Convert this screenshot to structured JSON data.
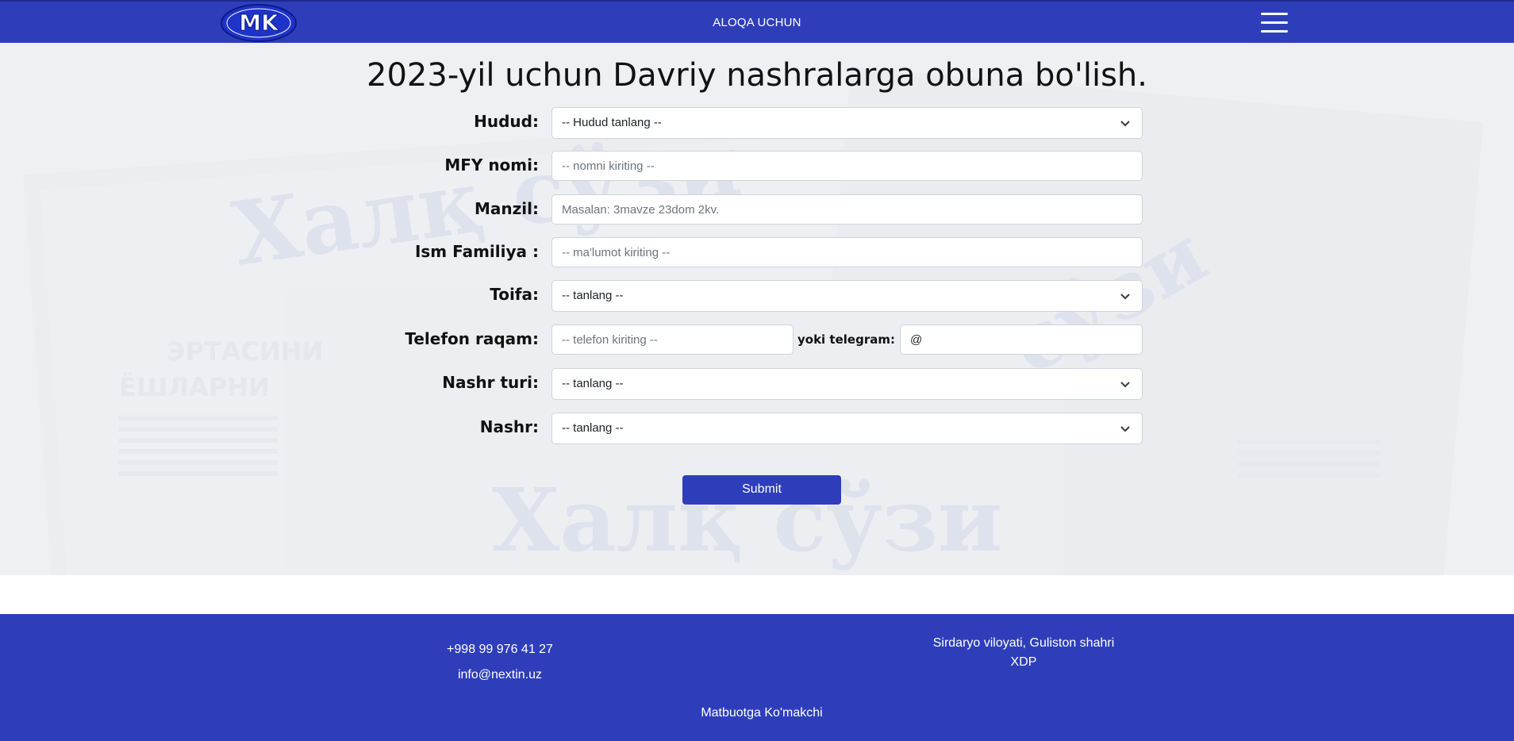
{
  "header": {
    "logo_text": "MK",
    "nav_link": "ALOQA UCHUN",
    "menu_icon": "hamburger-menu-icon"
  },
  "form": {
    "title": "2023-yil uchun Davriy nashralarga obuna bo'lish.",
    "hudud": {
      "label": "Hudud:",
      "value": "-- Hudud tanlang --"
    },
    "mfy": {
      "label": "MFY nomi:",
      "placeholder": "-- nomni kiriting --"
    },
    "manzil": {
      "label": "Manzil:",
      "placeholder": "Masalan: 3mavze 23dom 2kv."
    },
    "ism": {
      "label": "Ism Familiya :",
      "placeholder": "-- ma'lumot kiriting --"
    },
    "toifa": {
      "label": "Toifa:",
      "value": "-- tanlang --"
    },
    "telefon": {
      "label": "Telefon raqam:",
      "placeholder": "-- telefon kiriting --",
      "telegram_label": "yoki telegram:",
      "telegram_value": "@"
    },
    "nashr_turi": {
      "label": "Nashr turi:",
      "value": "-- tanlang --"
    },
    "nashr": {
      "label": "Nashr:",
      "value": "-- tanlang --"
    },
    "submit": "Submit"
  },
  "footer": {
    "phone": "+998 99 976 41 27",
    "email": "info@nextin.uz",
    "address_line1": "Sirdaryo viloyati, Guliston shahri",
    "address_line2": "XDP",
    "brand": "Matbuotga Ko'makchi"
  },
  "colors": {
    "primary": "#2e3ebb",
    "background": "#ffffff"
  }
}
